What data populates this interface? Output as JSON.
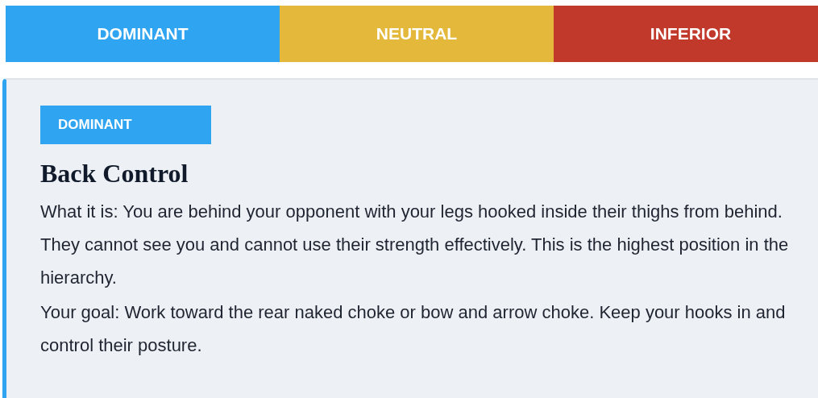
{
  "tabs": [
    {
      "label": "DOMINANT",
      "color": "#2fa4f0"
    },
    {
      "label": "NEUTRAL",
      "color": "#e3b83b"
    },
    {
      "label": "INFERIOR",
      "color": "#c0392b"
    }
  ],
  "card": {
    "badge": {
      "label": "DOMINANT",
      "color": "#2fa4f0"
    },
    "title": "Back Control",
    "paragraphs": [
      "What it is: You are behind your opponent with your legs hooked inside their thighs from behind. They cannot see you and cannot use their strength effectively. This is the highest position in the hierarchy.",
      "Your goal: Work toward the rear naked choke or bow and arrow choke. Keep your hooks in and control their posture."
    ]
  }
}
